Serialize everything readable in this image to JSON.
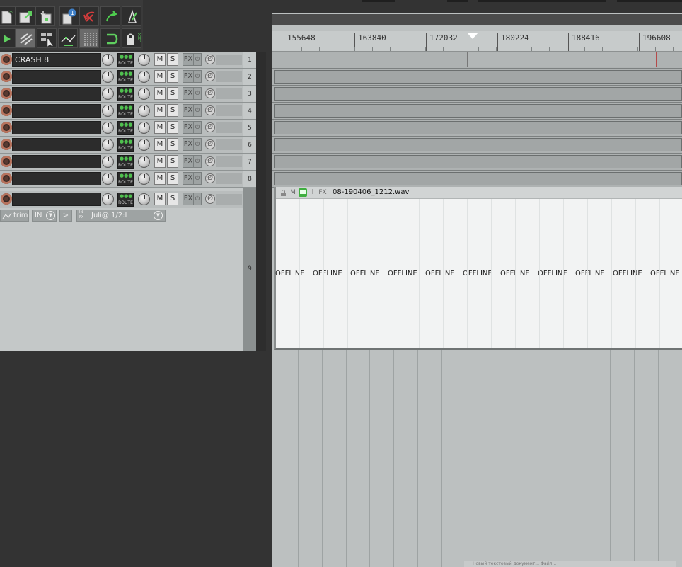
{
  "toolbar": {
    "row1": [
      {
        "name": "new-project-icon"
      },
      {
        "name": "open-project-icon"
      },
      {
        "name": "save-project-icon"
      },
      {
        "name": "project-tabs-icon",
        "badge": "1"
      },
      {
        "name": "undo-icon"
      },
      {
        "name": "redo-icon"
      },
      {
        "name": "metronome-icon"
      }
    ],
    "row2": [
      {
        "name": "cursor-tool-icon"
      },
      {
        "name": "ripple-edit-icon"
      },
      {
        "name": "grouping-icon"
      },
      {
        "name": "envelope-points-icon"
      },
      {
        "name": "grid-icon"
      },
      {
        "name": "snap-icon"
      },
      {
        "name": "lock-icon",
        "label": "LOCK"
      }
    ]
  },
  "colors": {
    "background": "#333333",
    "tcp": "#c4c8c8",
    "arrange": "#bcc0c0",
    "cursor": "#7a2020",
    "route_led": "#4fc04f"
  },
  "tracks": [
    {
      "number": "1",
      "name": "CRASH 8",
      "route": "ROUTE",
      "mute": "M",
      "solo": "S",
      "fx": "FX",
      "fx_power": "⏻",
      "phase": "Ø"
    },
    {
      "number": "2",
      "name": "",
      "route": "ROUTE",
      "mute": "M",
      "solo": "S",
      "fx": "FX",
      "fx_power": "⏻",
      "phase": "Ø"
    },
    {
      "number": "3",
      "name": "",
      "route": "ROUTE",
      "mute": "M",
      "solo": "S",
      "fx": "FX",
      "fx_power": "⏻",
      "phase": "Ø"
    },
    {
      "number": "4",
      "name": "",
      "route": "ROUTE",
      "mute": "M",
      "solo": "S",
      "fx": "FX",
      "fx_power": "⏻",
      "phase": "Ø"
    },
    {
      "number": "5",
      "name": "",
      "route": "ROUTE",
      "mute": "M",
      "solo": "S",
      "fx": "FX",
      "fx_power": "⏻",
      "phase": "Ø"
    },
    {
      "number": "6",
      "name": "",
      "route": "ROUTE",
      "mute": "M",
      "solo": "S",
      "fx": "FX",
      "fx_power": "⏻",
      "phase": "Ø"
    },
    {
      "number": "7",
      "name": "",
      "route": "ROUTE",
      "mute": "M",
      "solo": "S",
      "fx": "FX",
      "fx_power": "⏻",
      "phase": "Ø"
    },
    {
      "number": "8",
      "name": "",
      "route": "ROUTE",
      "mute": "M",
      "solo": "S",
      "fx": "FX",
      "fx_power": "⏻",
      "phase": "Ø"
    },
    {
      "number": "9",
      "name": "",
      "route": "ROUTE",
      "mute": "M",
      "solo": "S",
      "fx": "FX",
      "fx_power": "⏻",
      "phase": "Ø"
    }
  ],
  "track9_controls": {
    "env_mode": "trim",
    "input_label": "IN",
    "input_fx": "IN FX",
    "input_device": "Juli@ 1/2:L",
    "dropdown_glyph": "▼",
    "monitor_glyph": ">"
  },
  "ruler": {
    "labels": [
      "155648",
      "163840",
      "172032",
      "180224",
      "188416",
      "196608"
    ]
  },
  "item9": {
    "filename": "08-190406_1212.wav",
    "icons": {
      "lock": "🔒",
      "mute": "M",
      "notes": "▪",
      "info": "i",
      "fx": "FX"
    },
    "offline_labels": [
      "OFFLINE",
      "OFFLINE",
      "OFFLINE",
      "OFFLINE",
      "OFFLINE",
      "OFFLINE",
      "OFFLINE",
      "OFFLINE",
      "OFFLINE",
      "OFFLINE",
      "OFFLINE"
    ]
  },
  "tooltip": "Новый текстовый документ...  Файл..."
}
